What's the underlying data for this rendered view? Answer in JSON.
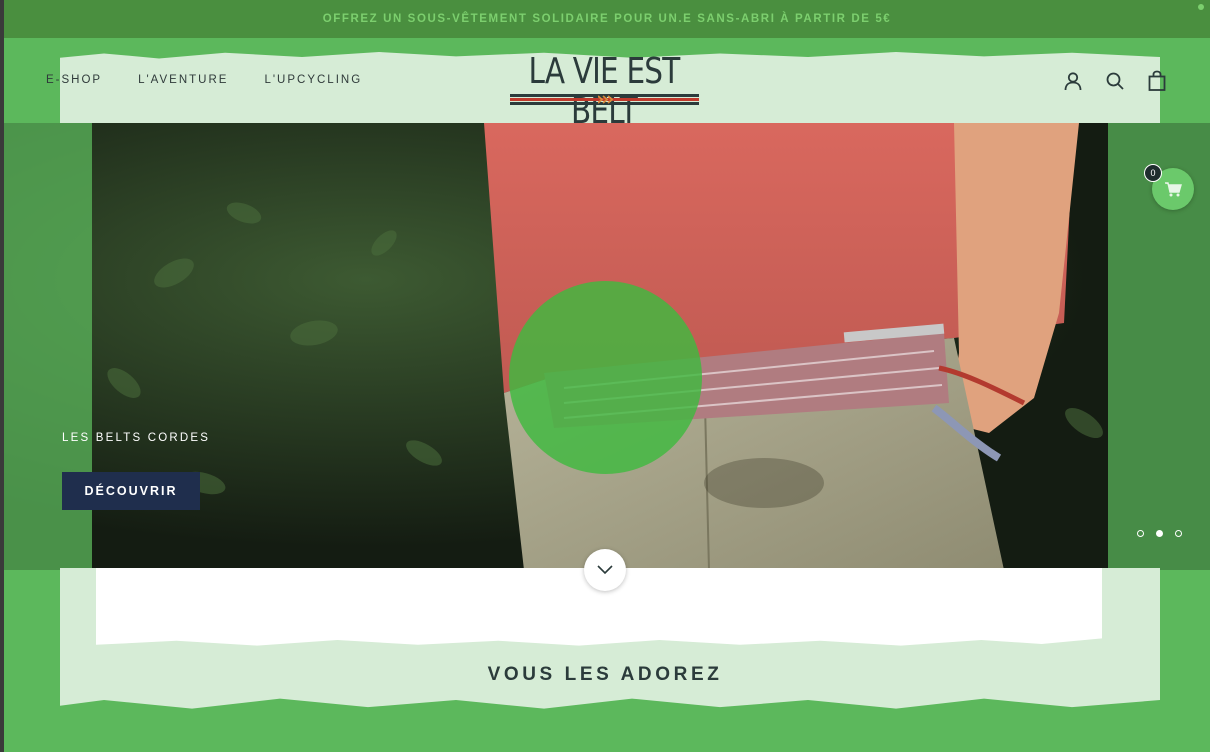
{
  "promo": {
    "text": "OFFREZ UN SOUS-VÊTEMENT SOLIDAIRE POUR UN.E SANS-ABRI À PARTIR DE 5€"
  },
  "nav": {
    "items": [
      "E-SHOP",
      "L'AVENTURE",
      "L'UPCYCLING"
    ]
  },
  "logo": {
    "text": "LA VIE EST BELT",
    "stripe_colors": [
      "#2b3b3b",
      "#c0392b",
      "#2b3b3b"
    ]
  },
  "header_icons": [
    "account-icon",
    "search-icon",
    "bag-icon"
  ],
  "hero": {
    "title": "LES BELTS CORDES",
    "cta": "DÉCOUVRIR",
    "slides_total": 3,
    "active_slide": 2
  },
  "floating_cart": {
    "count": "0"
  },
  "section": {
    "title": "VOUS LES ADOREZ"
  },
  "colors": {
    "brand_green": "#5cb85c",
    "dark_green": "#4a8f3f",
    "light_green": "#d6ecd6",
    "navy": "#1f2e4d",
    "text_dark": "#2b3b3b"
  }
}
